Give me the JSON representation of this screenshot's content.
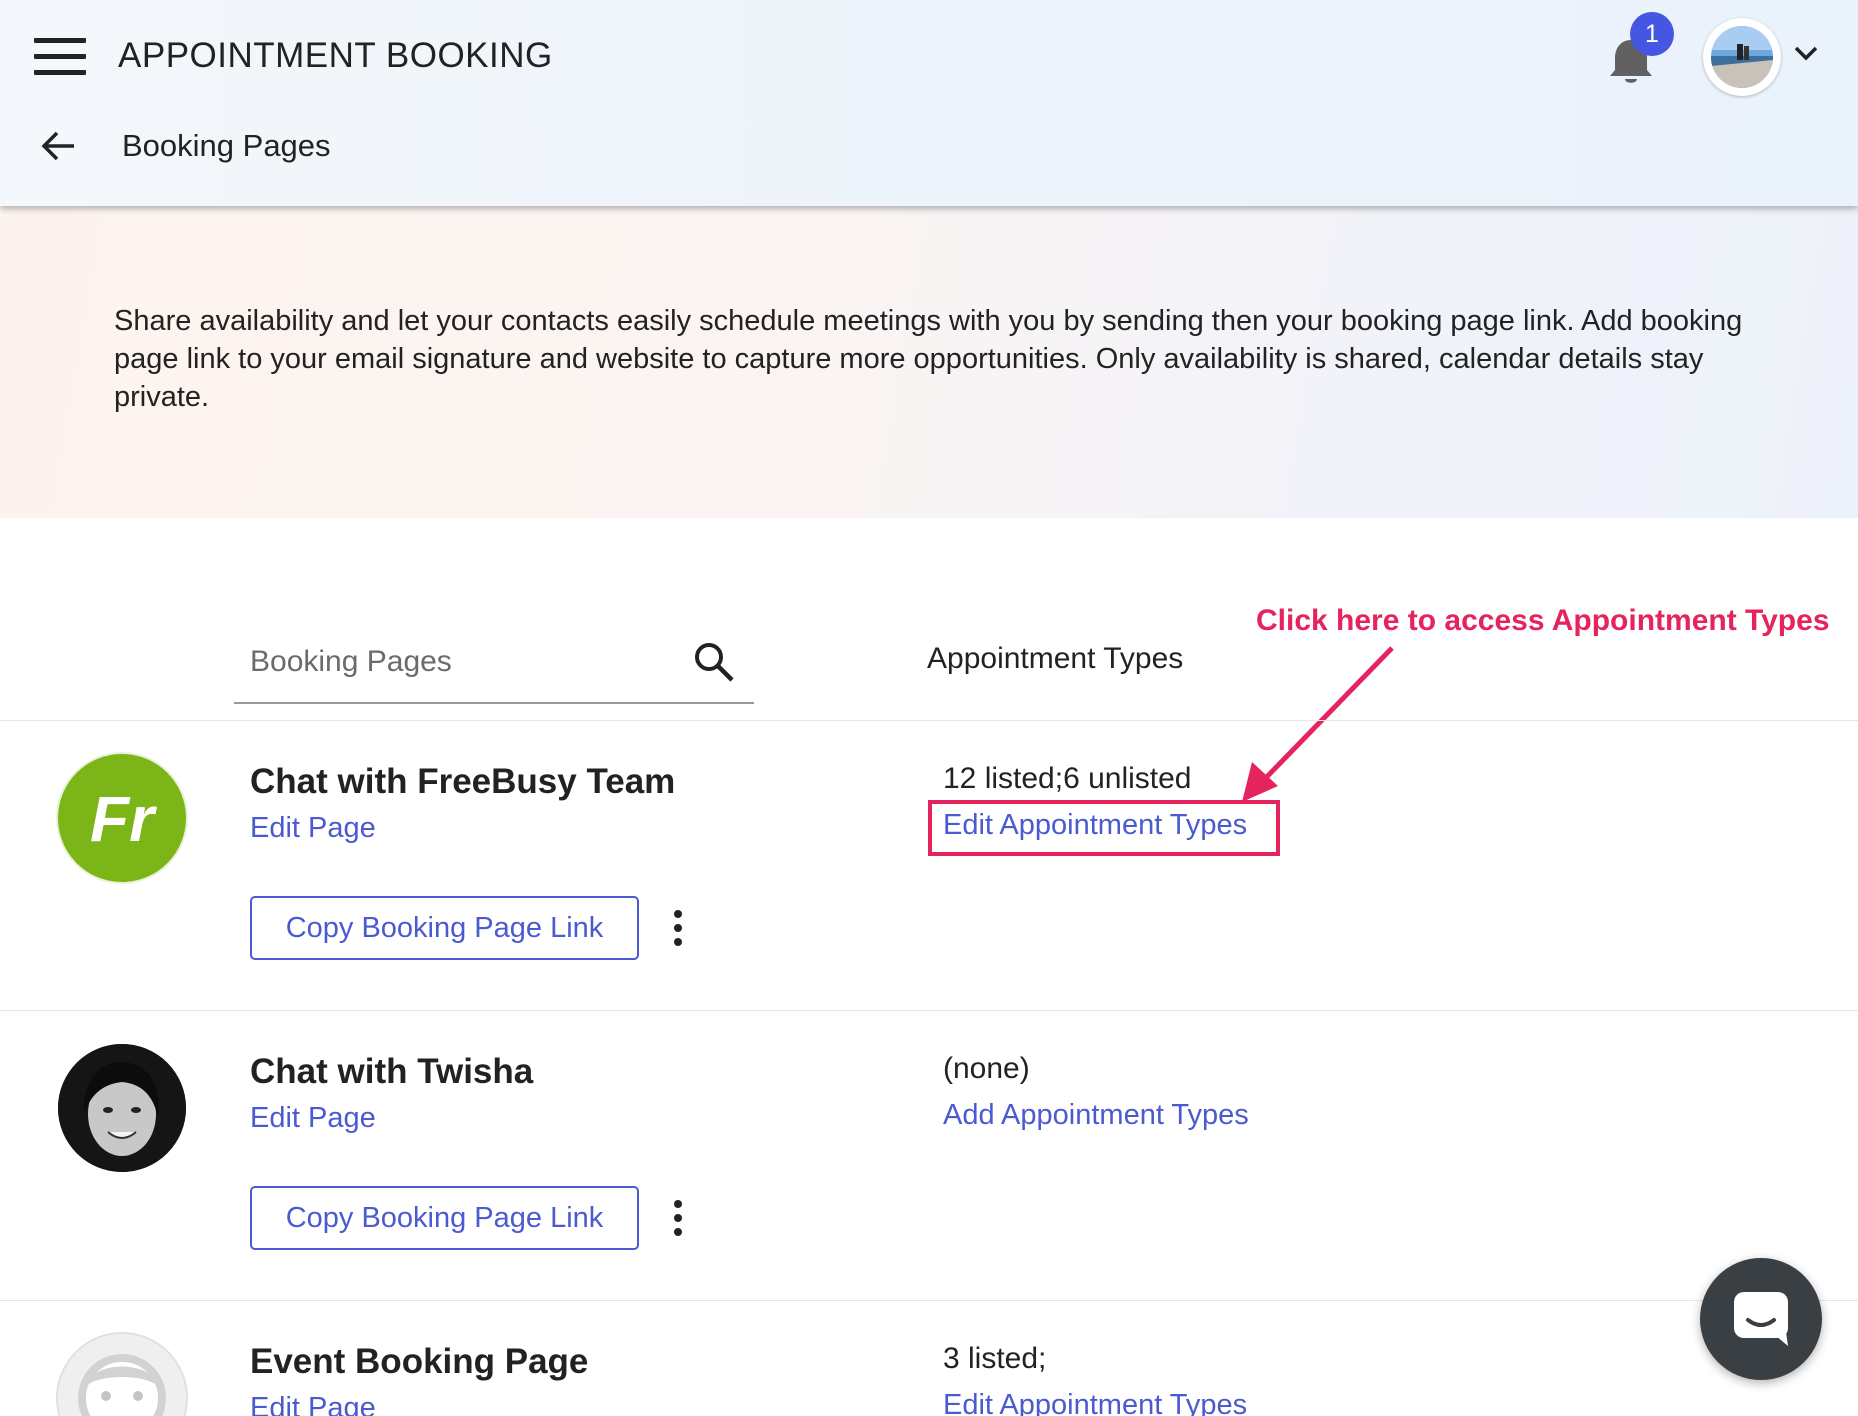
{
  "header": {
    "app_title": "APPOINTMENT BOOKING",
    "notification_count": "1",
    "page_title": "Booking Pages"
  },
  "intro": {
    "text": "Share availability and let your contacts easily schedule meetings with you by sending then your booking page link. Add booking page link to your email signature and website to capture more opportunities. Only availability is shared, calendar details stay private."
  },
  "list": {
    "search_placeholder": "Booking Pages",
    "column_header": "Appointment Types"
  },
  "annotation": {
    "text": "Click here to access Appointment Types"
  },
  "rows": [
    {
      "name": "Chat with FreeBusy Team",
      "avatar": "Fr",
      "edit_page": "Edit Page",
      "copy_button": "Copy Booking Page Link",
      "summary": "12 listed;6 unlisted",
      "action": "Edit Appointment Types"
    },
    {
      "name": "Chat with Twisha",
      "edit_page": "Edit Page",
      "copy_button": "Copy Booking Page Link",
      "summary": "(none)",
      "action": "Add Appointment Types"
    },
    {
      "name": "Event Booking Page",
      "edit_page": "Edit Page",
      "summary": "3 listed;",
      "action": "Edit Appointment Types"
    }
  ],
  "colors": {
    "accent": "#4a5ad0",
    "badge": "#4556e3",
    "annotation": "#e5245e",
    "brand_green": "#7cb518"
  },
  "icons": [
    "menu-icon",
    "bell-icon",
    "chevron-down-icon",
    "back-arrow-icon",
    "search-icon",
    "more-vert-icon",
    "chat-icon"
  ]
}
